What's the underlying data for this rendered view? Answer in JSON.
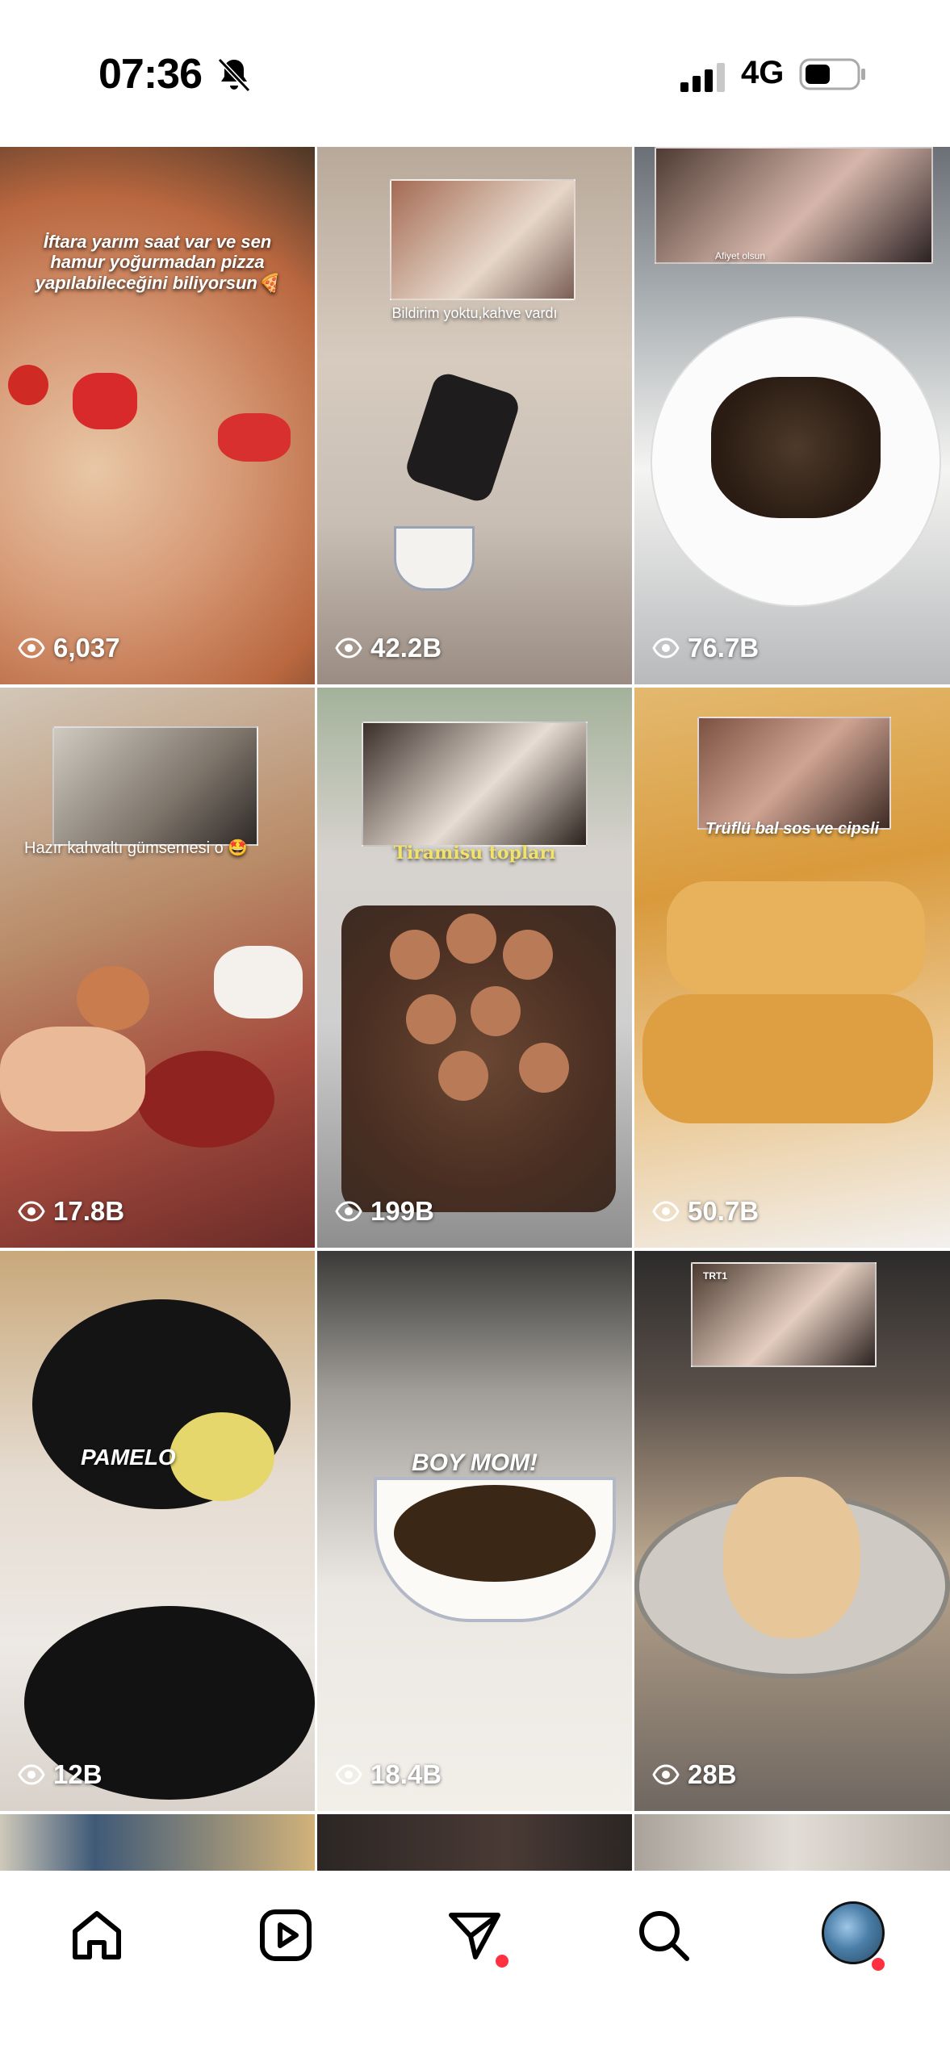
{
  "status": {
    "time": "07:36",
    "network": "4G"
  },
  "colors": {
    "notification_dot": "#ff3040",
    "overlay_text": "#ffffff"
  },
  "grid": {
    "tiles": [
      {
        "views": "6,037",
        "caption": "İftara yarım saat var ve sen hamur yoğurmadan pizza yapılabileceğini biliyorsun🍕"
      },
      {
        "views": "42.2B",
        "caption": "Bildirim yoktu,kahve vardı"
      },
      {
        "views": "76.7B",
        "caption": "Afiyet olsun"
      },
      {
        "views": "17.8B",
        "caption": "Hazır kahvaltı gümsemesi o 🤩"
      },
      {
        "views": "199B",
        "caption": "Tiramisu topları"
      },
      {
        "views": "50.7B",
        "caption": "Trüflü bal sos ve cipsli"
      },
      {
        "views": "12B",
        "caption": "PAMELO"
      },
      {
        "views": "18.4B",
        "caption": "BOY MOM!"
      },
      {
        "views": "28B",
        "caption": "TRT1"
      }
    ]
  },
  "nav": {
    "items": [
      {
        "name": "home",
        "icon": "home-icon"
      },
      {
        "name": "reels",
        "icon": "reels-icon"
      },
      {
        "name": "messages",
        "icon": "direct-message-icon"
      },
      {
        "name": "search",
        "icon": "search-icon"
      },
      {
        "name": "profile",
        "icon": "avatar"
      }
    ]
  }
}
